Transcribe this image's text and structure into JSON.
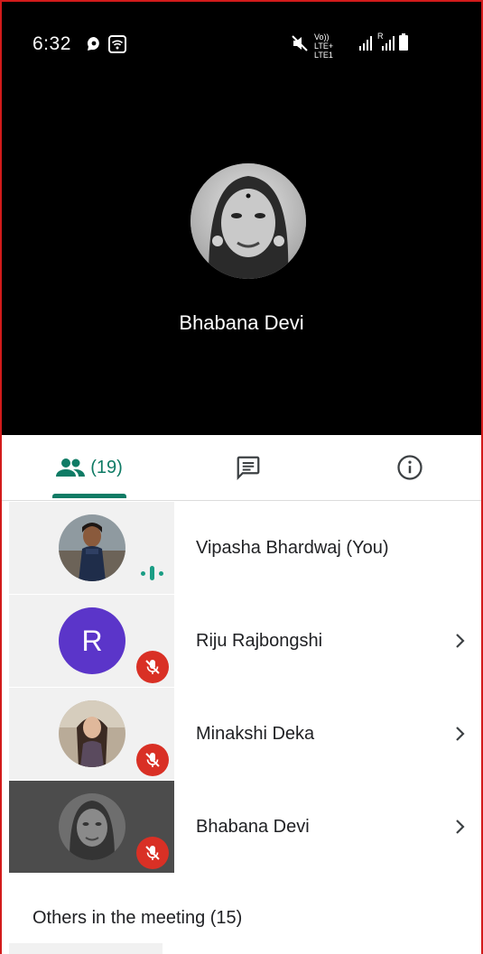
{
  "status_bar": {
    "time": "6:32",
    "network_text": "Vo)) LTE+ LTE1",
    "sim_text": "R"
  },
  "main_video": {
    "speaker_name": "Bhabana Devi"
  },
  "tabs": {
    "people_count": "(19)",
    "people_icon": "people-icon",
    "chat_icon": "chat-icon",
    "info_icon": "info-icon"
  },
  "participants": [
    {
      "name": "Vipasha Bhardwaj (You)",
      "avatar": "photo",
      "status": "speaking"
    },
    {
      "name": "Riju Rajbongshi",
      "avatar_letter": "R",
      "status": "muted"
    },
    {
      "name": "Minakshi Deka",
      "avatar": "photo",
      "status": "muted"
    },
    {
      "name": "Bhabana Devi",
      "avatar": "photo",
      "status": "muted"
    }
  ],
  "others_section": {
    "label": "Others in the meeting (15)"
  },
  "colors": {
    "accent": "#0f7b65",
    "mute_red": "#d93025",
    "avatar_purple": "#5b35c9"
  }
}
